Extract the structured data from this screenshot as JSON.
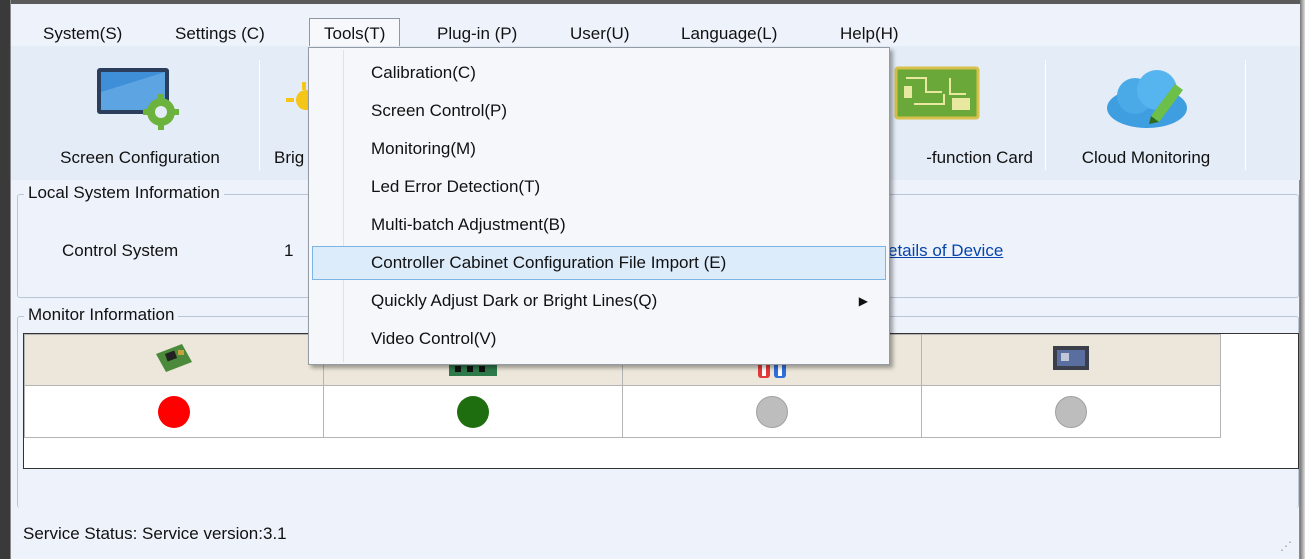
{
  "menubar": {
    "items": [
      {
        "label": "System(S)"
      },
      {
        "label": "Settings (C)"
      },
      {
        "label": "Tools(T)"
      },
      {
        "label": "Plug-in (P)"
      },
      {
        "label": "User(U)"
      },
      {
        "label": "Language(L)"
      },
      {
        "label": "Help(H)"
      }
    ]
  },
  "toolbar": {
    "screen_configuration": "Screen Configuration",
    "brightness_partial": "Brig",
    "multifunction_partial": "-function Card",
    "cloud_monitoring": "Cloud Monitoring"
  },
  "local_system": {
    "title": "Local System Information",
    "control_system_label": "Control System",
    "control_system_value": "1",
    "details_link": "etails of Device"
  },
  "monitor": {
    "title": "Monitor Information",
    "columns": [
      {
        "icon": "receiving-card-icon",
        "status_color": "#ff0000"
      },
      {
        "icon": "sending-card-icon",
        "status_color": "#1e6e10"
      },
      {
        "icon": "temperature-icon",
        "status_color": "#bdbdbd"
      },
      {
        "icon": "multifunction-card-icon",
        "status_color": "#bdbdbd"
      }
    ]
  },
  "status_bar": {
    "text": "Service Status:  Service version:3.1"
  },
  "tools_menu": {
    "items": [
      {
        "label": "Calibration(C)"
      },
      {
        "label": "Screen Control(P)"
      },
      {
        "label": "Monitoring(M)"
      },
      {
        "label": "Led Error Detection(T)"
      },
      {
        "label": "Multi-batch Adjustment(B)"
      },
      {
        "label": "Controller Cabinet Configuration File Import (E)"
      },
      {
        "label": "Quickly Adjust Dark or Bright Lines(Q)"
      },
      {
        "label": "Video Control(V)"
      }
    ]
  }
}
